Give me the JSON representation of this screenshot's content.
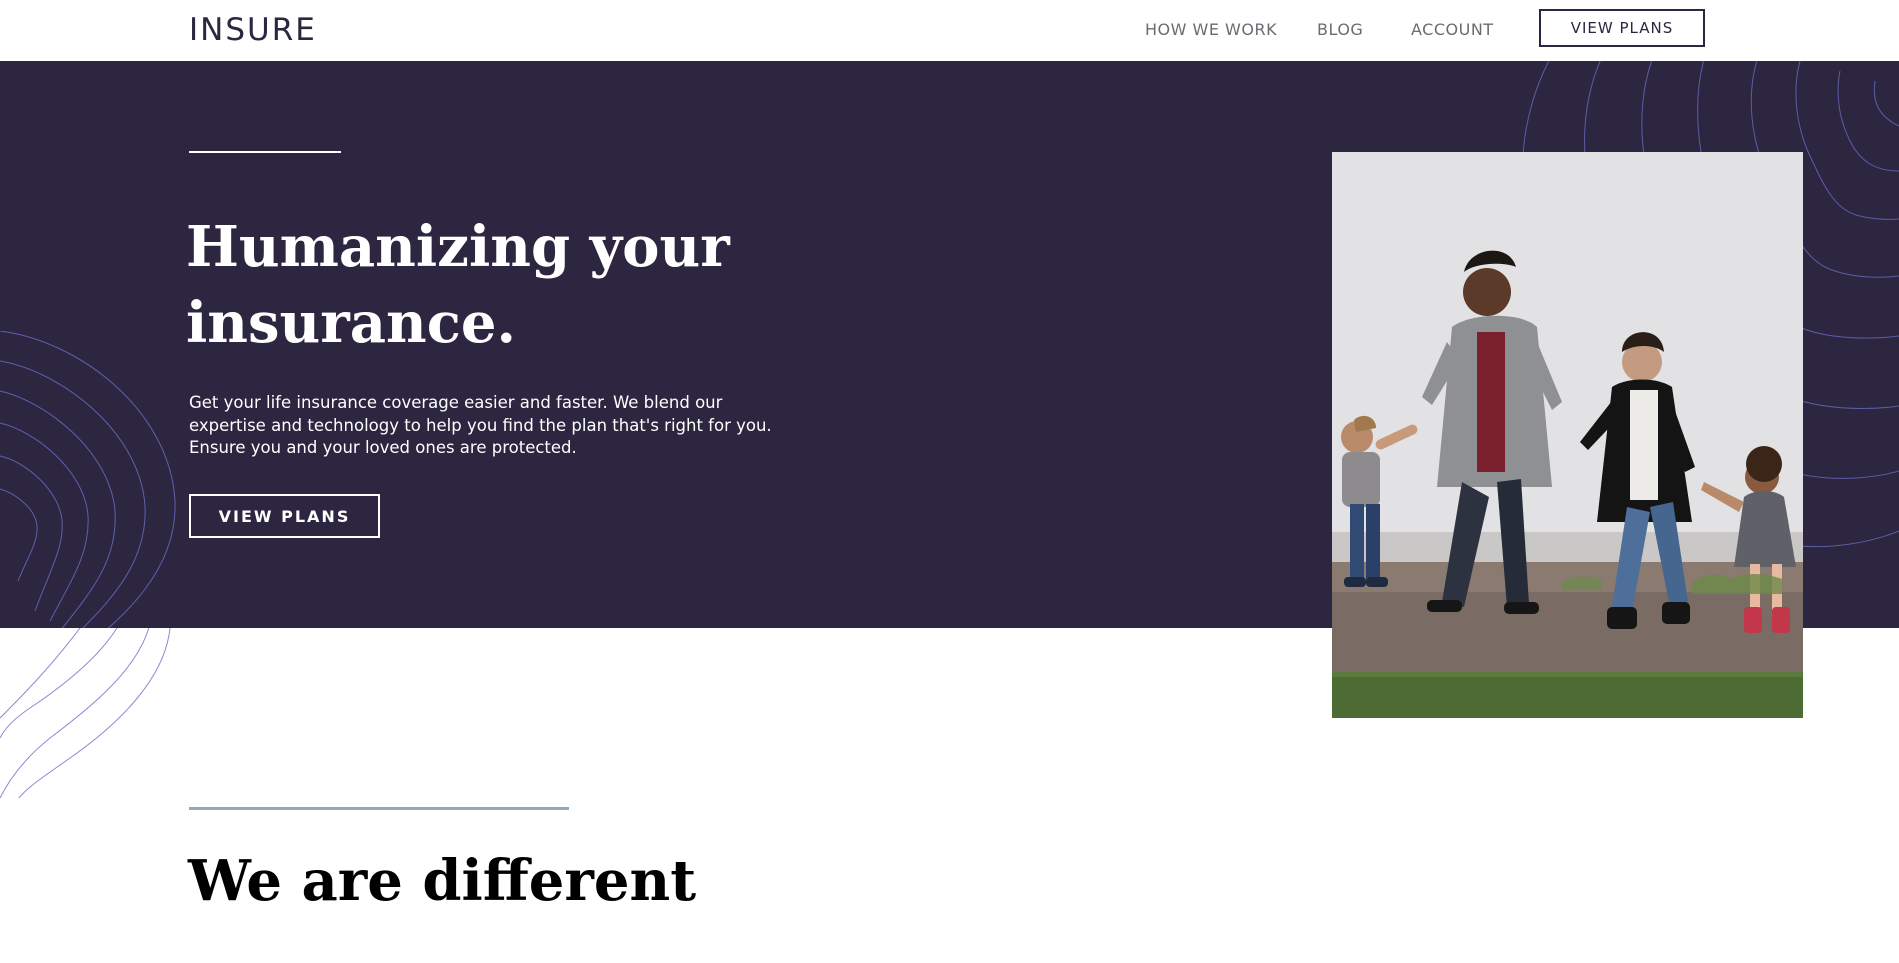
{
  "header": {
    "logo": "INSURE",
    "nav": [
      {
        "label": "HOW WE WORK"
      },
      {
        "label": "BLOG"
      },
      {
        "label": "ACCOUNT"
      }
    ],
    "cta_label": "VIEW PLANS"
  },
  "hero": {
    "title_line1": "Humanizing your",
    "title_line2": "insurance.",
    "text": "Get your life insurance coverage easier and faster. We blend our expertise and technology to help you find the plan that's right for you. Ensure you and your loved ones are protected.",
    "cta_label": "VIEW PLANS"
  },
  "section": {
    "title": "We are different"
  },
  "colors": {
    "hero_bg": "#2d2640",
    "accent_line": "#93a9bc",
    "contour": "#6c6fc9"
  }
}
